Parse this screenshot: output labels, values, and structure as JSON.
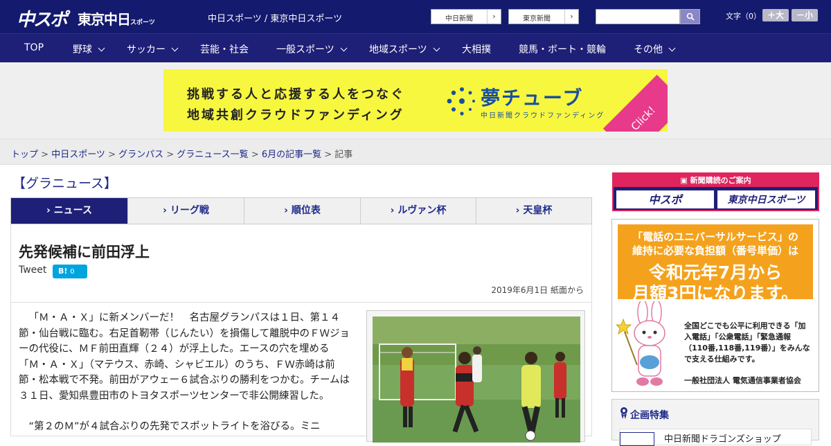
{
  "header": {
    "logo_chuspo": "中スポ",
    "logo_tokyo": "東京中日",
    "logo_tokyo_small": "スポーツ",
    "site_names": "中日スポーツ / 東京中日スポーツ",
    "paper_links": [
      "中日新聞",
      "東京新聞"
    ],
    "search_placeholder": "",
    "font_size_label": "文字（0）",
    "font_up": "＋大",
    "font_down": "－小"
  },
  "nav": [
    {
      "label": "TOP",
      "dropdown": false
    },
    {
      "label": "野球",
      "dropdown": true
    },
    {
      "label": "サッカー",
      "dropdown": true
    },
    {
      "label": "芸能・社会",
      "dropdown": false
    },
    {
      "label": "一般スポーツ",
      "dropdown": true
    },
    {
      "label": "地域スポーツ",
      "dropdown": true
    },
    {
      "label": "大相撲",
      "dropdown": false
    },
    {
      "label": "競馬・ボート・競輪",
      "dropdown": false
    },
    {
      "label": "その他",
      "dropdown": true
    }
  ],
  "ad_banner": {
    "line1": "挑戦する人と応援する人をつなぐ",
    "line2": "地域共創クラウドファンディング",
    "brand": "夢チューブ",
    "brand_sub": "中日新聞クラウドファンディング",
    "click": "Click!"
  },
  "breadcrumb": {
    "links": [
      "トップ",
      "中日スポーツ",
      "グランパス",
      "グラニュース一覧",
      "6月の記事一覧"
    ],
    "separator": " > ",
    "current": "記事"
  },
  "section_title": "【グラニュース】",
  "tabs": [
    {
      "label": "ニュース",
      "active": true
    },
    {
      "label": "リーグ戦",
      "active": false
    },
    {
      "label": "順位表",
      "active": false
    },
    {
      "label": "ルヴァン杯",
      "active": false
    },
    {
      "label": "天皇杯",
      "active": false
    }
  ],
  "article": {
    "headline": "先発候補に前田浮上",
    "tweet": "Tweet",
    "hatena_label": "B!",
    "hatena_count": "0",
    "date": "2019年6月1日 紙面から",
    "paragraphs": [
      "「Ｍ・Ａ・Ｘ」に新メンバーだ！　名古屋グランパスは１日、第１４節・仙台戦に臨む。右足首靭帯（じんたい）を損傷して離脱中のＦＷジョーの代役に、ＭＦ前田直輝（２４）が浮上した。エースの穴を埋める「Ｍ・Ａ・Ｘ」（マテウス、赤崎、シャビエル）のうち、ＦＷ赤崎は前節・松本戦で不発。前田がアウェー６試合ぶりの勝利をつかむ。チームは３１日、愛知県豊田市のトヨタスポーツセンターで非公開練習した。",
      "“第２のＭ”が４試合ぶりの先発でスポットライトを浴びる。ミニ"
    ]
  },
  "sidebar": {
    "subscribe_head": "新聞購読のご案内",
    "subscribe_buttons": [
      "中スポ",
      "東京中日スポーツ"
    ],
    "ad": {
      "line1": "「電話のユニバーサルサービス」の",
      "line2": "維持に必要な負担額（番号単価）は",
      "line3": "令和元年7月から",
      "line4": "月額3円になります。",
      "body": "全国どこでも公平に利用できる「加入電話」「公衆電話」「緊急通報（110番,118番,119番）」をみんなで支える仕組みです。",
      "org": "一般社団法人 電気通信事業者協会"
    },
    "feature_title": "企画特集",
    "feature_item": "中日新聞ドラゴンズショップ"
  },
  "colors": {
    "header_bg": "#141a6e",
    "nav_bg": "#1e1f77",
    "accent_pink": "#e0245e",
    "hatena": "#00a4de"
  }
}
